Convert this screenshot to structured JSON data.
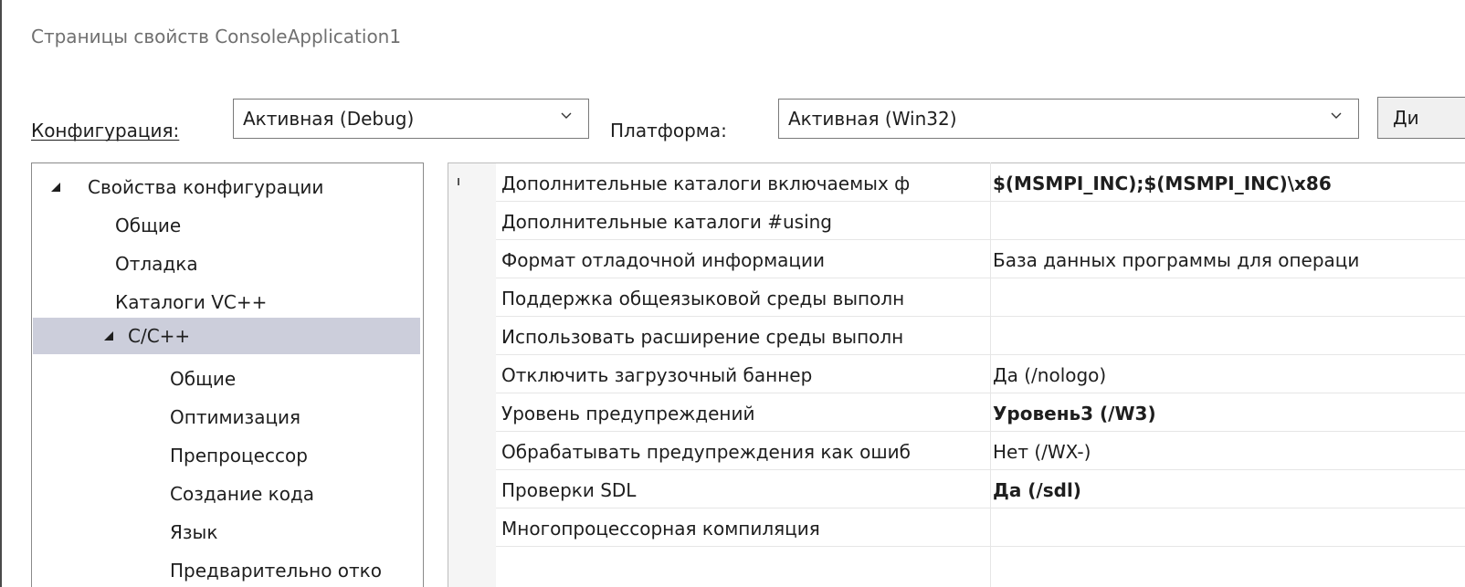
{
  "window": {
    "title": "Страницы свойств ConsoleApplication1"
  },
  "toolbar": {
    "config_label": "Конфигурация:",
    "config_value": "Активная (Debug)",
    "platform_label": "Платформа:",
    "platform_value": "Активная (Win32)",
    "config_manager_button": "Ди"
  },
  "tree": {
    "items": [
      "Свойства конфигурации",
      "Общие",
      "Отладка",
      "Каталоги VC++",
      "C/C++",
      "Общие",
      "Оптимизация",
      "Препроцессор",
      "Создание кода",
      "Язык",
      "Предварительно отко"
    ],
    "selected": "C/C++"
  },
  "grid": {
    "rows": [
      {
        "name": "Дополнительные каталоги включаемых ф",
        "value": "$(MSMPI_INC);$(MSMPI_INC)\\x86"
      },
      {
        "name": "Дополнительные каталоги #using",
        "value": ""
      },
      {
        "name": "Формат отладочной информации",
        "value": "База данных программы для операци"
      },
      {
        "name": "Поддержка общеязыковой среды выполн",
        "value": ""
      },
      {
        "name": "Использовать расширение среды выполн",
        "value": ""
      },
      {
        "name": "Отключить загрузочный баннер",
        "value": "Да (/nologo)"
      },
      {
        "name": "Уровень предупреждений",
        "value": "Уровень3 (/W3)"
      },
      {
        "name": "Обрабатывать предупреждения как ошиб",
        "value": "Нет (/WX-)"
      },
      {
        "name": "Проверки SDL",
        "value": "Да (/sdl)"
      },
      {
        "name": "Многопроцессорная компиляция",
        "value": ""
      }
    ]
  },
  "colors": {
    "selection": "#cccedb",
    "border": "#7a7a7a",
    "title_text": "#707070"
  }
}
